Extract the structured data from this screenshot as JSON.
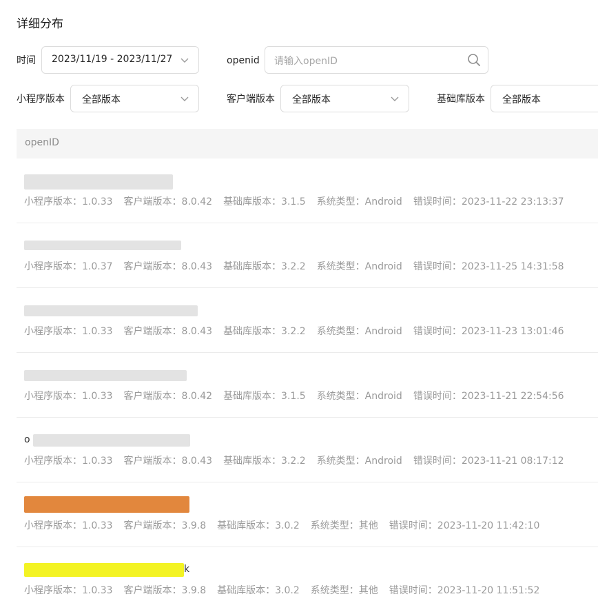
{
  "page": {
    "title": "详细分布"
  },
  "filters": {
    "time_label": "时间",
    "time_value": "2023/11/19 - 2023/11/27",
    "openid_label": "openid",
    "openid_placeholder": "请输入openID",
    "miniprogram_label": "小程序版本",
    "miniprogram_value": "全部版本",
    "client_label": "客户端版本",
    "client_value": "全部版本",
    "baselib_label": "基础库版本",
    "baselib_value": "全部版本"
  },
  "table": {
    "header": "openID",
    "rows": [
      {
        "openid_mask": "gray",
        "openid_visible": "",
        "mp": "小程序版本：1.0.33",
        "client": "客户端版本：8.0.42",
        "base": "基础库版本：3.1.5",
        "sys": "系统类型：Android",
        "err": "错误时间：2023-11-22 23:13:37"
      },
      {
        "openid_mask": "gray",
        "openid_visible": "",
        "mp": "小程序版本：1.0.37",
        "client": "客户端版本：8.0.43",
        "base": "基础库版本：3.2.2",
        "sys": "系统类型：Android",
        "err": "错误时间：2023-11-25 14:31:58"
      },
      {
        "openid_mask": "gray",
        "openid_visible": "",
        "mp": "小程序版本：1.0.33",
        "client": "客户端版本：8.0.43",
        "base": "基础库版本：3.2.2",
        "sys": "系统类型：Android",
        "err": "错误时间：2023-11-23 13:01:46"
      },
      {
        "openid_mask": "gray",
        "openid_visible": "",
        "mp": "小程序版本：1.0.33",
        "client": "客户端版本：8.0.42",
        "base": "基础库版本：3.1.5",
        "sys": "系统类型：Android",
        "err": "错误时间：2023-11-21 22:54:56"
      },
      {
        "openid_mask": "gray",
        "openid_visible": "o",
        "mp": "小程序版本：1.0.33",
        "client": "客户端版本：8.0.43",
        "base": "基础库版本：3.2.2",
        "sys": "系统类型：Android",
        "err": "错误时间：2023-11-21 08:17:12"
      },
      {
        "openid_mask": "orange",
        "openid_visible": "",
        "mp": "小程序版本：1.0.33",
        "client": "客户端版本：3.9.8",
        "base": "基础库版本：3.0.2",
        "sys": "系统类型：其他",
        "err": "错误时间：2023-11-20 11:42:10"
      },
      {
        "openid_mask": "yellow",
        "openid_visible": "k",
        "mp": "小程序版本：1.0.33",
        "client": "客户端版本：3.9.8",
        "base": "基础库版本：3.0.2",
        "sys": "系统类型：其他",
        "err": "错误时间：2023-11-20 11:51:52"
      }
    ]
  },
  "colors": {
    "mask_gray": "#e3e3e3",
    "mask_orange": "#e2873d",
    "mask_yellow": "#f3f324"
  },
  "icons": {
    "search": "search-icon",
    "chevron": "chevron-down-icon"
  }
}
